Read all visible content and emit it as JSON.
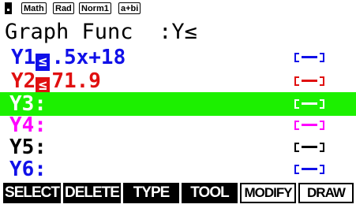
{
  "status": {
    "badges": [
      "Math",
      "Rad",
      "Norm1",
      "a+bi"
    ]
  },
  "title": "Graph Func  :Y≤",
  "colors": {
    "blue": "#1010e8",
    "red": "#e01010",
    "magenta": "#ff00ff",
    "black": "#000000",
    "highlight": "#1cf000"
  },
  "rows": [
    {
      "name": "Y1",
      "sign": "≤",
      "expr": ".5x+18",
      "color": "blue"
    },
    {
      "name": "Y2",
      "sign": "≤",
      "expr": "71.9",
      "color": "red"
    },
    {
      "name": "Y3:",
      "sign": "",
      "expr": "",
      "color": "white",
      "selected": true
    },
    {
      "name": "Y4:",
      "sign": "",
      "expr": "",
      "color": "magenta"
    },
    {
      "name": "Y5:",
      "sign": "",
      "expr": "",
      "color": "black"
    },
    {
      "name": "Y6:",
      "sign": "",
      "expr": "",
      "color": "blue"
    }
  ],
  "menu": [
    "SELECT",
    "DELETE",
    "TYPE",
    "TOOL",
    "MODIFY",
    "DRAW"
  ]
}
